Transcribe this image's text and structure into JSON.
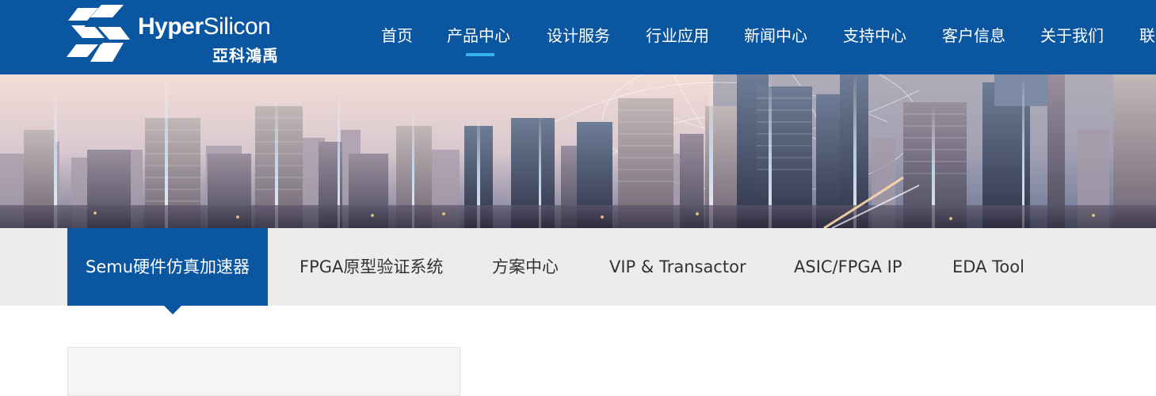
{
  "brand": {
    "name_prefix": "Hyper",
    "name_suffix": "Silicon",
    "name_cn": "亞科鴻禹"
  },
  "nav": {
    "items": [
      {
        "label": "首页"
      },
      {
        "label": "产品中心",
        "active": true
      },
      {
        "label": "设计服务"
      },
      {
        "label": "行业应用"
      },
      {
        "label": "新闻中心"
      },
      {
        "label": "支持中心"
      },
      {
        "label": "客户信息"
      },
      {
        "label": "关于我们"
      },
      {
        "label": "联"
      }
    ]
  },
  "subnav": {
    "items": [
      {
        "label": "Semu硬件仿真加速器",
        "active": true
      },
      {
        "label": "FPGA原型验证系统"
      },
      {
        "label": "方案中心"
      },
      {
        "label": "VIP & Transactor"
      },
      {
        "label": "ASIC/FPGA IP"
      },
      {
        "label": "EDA Tool"
      }
    ]
  },
  "colors": {
    "primary": "#0a56a0",
    "accent_underline": "#3ab1ec",
    "subnav_bg": "#ececec"
  }
}
